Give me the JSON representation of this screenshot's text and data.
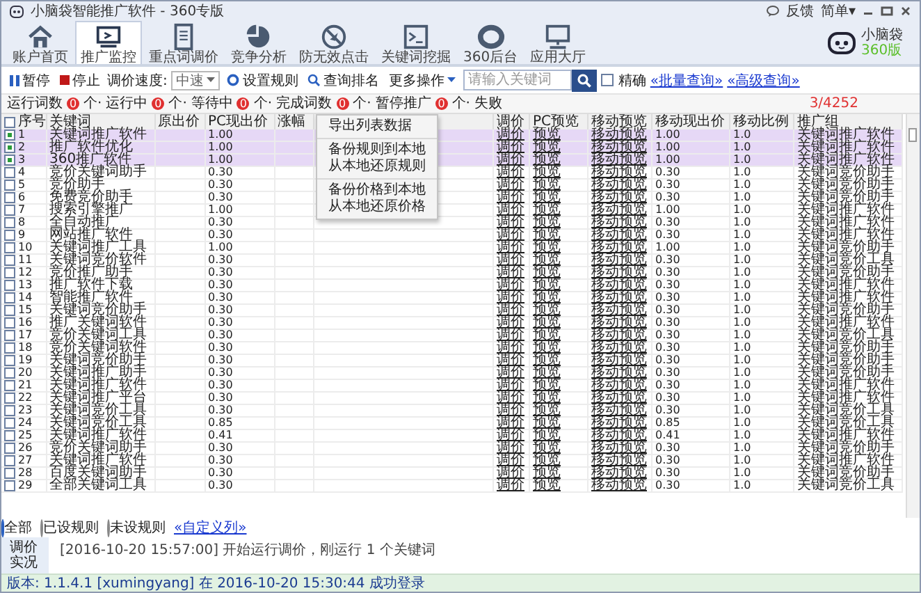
{
  "window": {
    "title": "小脑袋智能推广软件 - 360专版",
    "feedback": "反馈",
    "mode_menu": "简单▾",
    "logo_name": "小脑袋",
    "logo_edition": "360版"
  },
  "toolbar": [
    {
      "label": "账户首页",
      "selected": false
    },
    {
      "label": "推广监控",
      "selected": true
    },
    {
      "label": "重点词调价",
      "selected": false
    },
    {
      "label": "竞争分析",
      "selected": false
    },
    {
      "label": "防无效点击",
      "selected": false
    },
    {
      "label": "关键词挖掘",
      "selected": false
    },
    {
      "label": "360后台",
      "selected": false
    },
    {
      "label": "应用大厅",
      "selected": false
    }
  ],
  "actions": {
    "pause": "暂停",
    "stop": "停止",
    "speed_label": "调价速度:",
    "speed_value": "中速",
    "rules": "设置规则",
    "rank": "查询排名",
    "more": "更多操作",
    "search_placeholder": "请输入关键词",
    "exact": {
      "label": "精确",
      "checked": false
    },
    "batch_query": "«批量查询»",
    "advanced_query": "«高级查询»",
    "count": "3/4252"
  },
  "more_menu": [
    {
      "label": "导出列表数据",
      "separator_after": true
    },
    {
      "label": "备份规则到本地",
      "separator_after": false
    },
    {
      "label": "从本地还原规则",
      "separator_after": true
    },
    {
      "label": "备份价格到本地",
      "separator_after": false
    },
    {
      "label": "从本地还原价格",
      "separator_after": false
    }
  ],
  "stats": [
    {
      "label": "运行词数",
      "value": "0",
      "unit": "个·"
    },
    {
      "label": "运行中",
      "value": "0",
      "unit": "个·"
    },
    {
      "label": "等待中",
      "value": "0",
      "unit": "个·"
    },
    {
      "label": "完成词数",
      "value": "0",
      "unit": "个·"
    },
    {
      "label": "暂停推广",
      "value": "0",
      "unit": "个·"
    },
    {
      "label": "失败"
    }
  ],
  "table": {
    "all_checked": false,
    "columns": [
      "序号",
      "关键词",
      "原出价",
      "PC现出价",
      "涨幅",
      "调价",
      "PC预览",
      "移动预览",
      "移动现出价",
      "移动比例",
      "推广组"
    ],
    "rows": [
      {
        "checked": true,
        "no": "1",
        "keyword": "关键词推广软件",
        "pc_bid": "1.00",
        "adjust": "调价",
        "pc_preview": "预览",
        "mobile_preview": "移动预览",
        "mobile_bid": "1.00",
        "mobile_ratio": "1.0",
        "group": "关键词推广软件"
      },
      {
        "checked": true,
        "no": "2",
        "keyword": "推广软件优化",
        "pc_bid": "1.00",
        "adjust": "调价",
        "pc_preview": "预览",
        "mobile_preview": "移动预览",
        "mobile_bid": "1.00",
        "mobile_ratio": "1.0",
        "group": "关键词推广软件"
      },
      {
        "checked": true,
        "no": "3",
        "keyword": "360推广软件",
        "pc_bid": "1.00",
        "adjust": "调价",
        "pc_preview": "预览",
        "mobile_preview": "移动预览",
        "mobile_bid": "1.00",
        "mobile_ratio": "1.0",
        "group": "关键词推广软件"
      },
      {
        "checked": false,
        "no": "4",
        "keyword": "竞价关键词助手",
        "pc_bid": "0.30",
        "adjust": "调价",
        "pc_preview": "预览",
        "mobile_preview": "移动预览",
        "mobile_bid": "0.30",
        "mobile_ratio": "1.0",
        "group": "关键词竞价助手"
      },
      {
        "checked": false,
        "no": "5",
        "keyword": "竞价助手",
        "pc_bid": "0.30",
        "adjust": "调价",
        "pc_preview": "预览",
        "mobile_preview": "移动预览",
        "mobile_bid": "0.30",
        "mobile_ratio": "1.0",
        "group": "关键词竞价助手"
      },
      {
        "checked": false,
        "no": "6",
        "keyword": "免费竞价助手",
        "pc_bid": "0.30",
        "adjust": "调价",
        "pc_preview": "预览",
        "mobile_preview": "移动预览",
        "mobile_bid": "0.30",
        "mobile_ratio": "1.0",
        "group": "关键词竞价助手"
      },
      {
        "checked": false,
        "no": "7",
        "keyword": "搜索引擎推广",
        "pc_bid": "1.00",
        "adjust": "调价",
        "pc_preview": "预览",
        "mobile_preview": "移动预览",
        "mobile_bid": "1.00",
        "mobile_ratio": "1.0",
        "group": "关键词推广软件"
      },
      {
        "checked": false,
        "no": "8",
        "keyword": "全自动推广",
        "pc_bid": "0.30",
        "adjust": "调价",
        "pc_preview": "预览",
        "mobile_preview": "移动预览",
        "mobile_bid": "0.30",
        "mobile_ratio": "1.0",
        "group": "关键词推广软件"
      },
      {
        "checked": false,
        "no": "9",
        "keyword": "网站推广软件",
        "pc_bid": "0.30",
        "adjust": "调价",
        "pc_preview": "预览",
        "mobile_preview": "移动预览",
        "mobile_bid": "0.30",
        "mobile_ratio": "1.0",
        "group": "关键词推广软件"
      },
      {
        "checked": false,
        "no": "10",
        "keyword": "关键词推广工具",
        "pc_bid": "1.00",
        "adjust": "调价",
        "pc_preview": "预览",
        "mobile_preview": "移动预览",
        "mobile_bid": "1.00",
        "mobile_ratio": "1.0",
        "group": "关键词竞价助手"
      },
      {
        "checked": false,
        "no": "11",
        "keyword": "关键词竞价软件",
        "pc_bid": "0.30",
        "adjust": "调价",
        "pc_preview": "预览",
        "mobile_preview": "移动预览",
        "mobile_bid": "0.30",
        "mobile_ratio": "1.0",
        "group": "关键词竞价工具"
      },
      {
        "checked": false,
        "no": "12",
        "keyword": "竞价推广助手",
        "pc_bid": "0.30",
        "adjust": "调价",
        "pc_preview": "预览",
        "mobile_preview": "移动预览",
        "mobile_bid": "0.30",
        "mobile_ratio": "1.0",
        "group": "关键词竞价助手"
      },
      {
        "checked": false,
        "no": "13",
        "keyword": "推广软件下载",
        "pc_bid": "0.30",
        "adjust": "调价",
        "pc_preview": "预览",
        "mobile_preview": "移动预览",
        "mobile_bid": "0.30",
        "mobile_ratio": "1.0",
        "group": "关键词推广软件"
      },
      {
        "checked": false,
        "no": "14",
        "keyword": "智能推广软件",
        "pc_bid": "0.30",
        "adjust": "调价",
        "pc_preview": "预览",
        "mobile_preview": "移动预览",
        "mobile_bid": "0.30",
        "mobile_ratio": "1.0",
        "group": "关键词推广软件"
      },
      {
        "checked": false,
        "no": "15",
        "keyword": "关键词竞价助手",
        "pc_bid": "0.30",
        "adjust": "调价",
        "pc_preview": "预览",
        "mobile_preview": "移动预览",
        "mobile_bid": "0.30",
        "mobile_ratio": "1.0",
        "group": "关键词竞价助手"
      },
      {
        "checked": false,
        "no": "16",
        "keyword": "推广关键词软件",
        "pc_bid": "0.30",
        "adjust": "调价",
        "pc_preview": "预览",
        "mobile_preview": "移动预览",
        "mobile_bid": "0.30",
        "mobile_ratio": "1.0",
        "group": "关键词推广软件"
      },
      {
        "checked": false,
        "no": "17",
        "keyword": "竞价关键词工具",
        "pc_bid": "0.30",
        "adjust": "调价",
        "pc_preview": "预览",
        "mobile_preview": "移动预览",
        "mobile_bid": "0.30",
        "mobile_ratio": "1.0",
        "group": "关键词竞价工具"
      },
      {
        "checked": false,
        "no": "18",
        "keyword": "竞价关键词软件",
        "pc_bid": "0.30",
        "adjust": "调价",
        "pc_preview": "预览",
        "mobile_preview": "移动预览",
        "mobile_bid": "0.30",
        "mobile_ratio": "1.0",
        "group": "关键词竞价助手"
      },
      {
        "checked": false,
        "no": "19",
        "keyword": "关键词竞价助手",
        "pc_bid": "0.30",
        "adjust": "调价",
        "pc_preview": "预览",
        "mobile_preview": "移动预览",
        "mobile_bid": "0.30",
        "mobile_ratio": "1.0",
        "group": "关键词竞价助手"
      },
      {
        "checked": false,
        "no": "20",
        "keyword": "关键词推广助手",
        "pc_bid": "0.30",
        "adjust": "调价",
        "pc_preview": "预览",
        "mobile_preview": "移动预览",
        "mobile_bid": "0.30",
        "mobile_ratio": "1.0",
        "group": "关键词竞价助手"
      },
      {
        "checked": false,
        "no": "21",
        "keyword": "关键词推广软件",
        "pc_bid": "0.30",
        "adjust": "调价",
        "pc_preview": "预览",
        "mobile_preview": "移动预览",
        "mobile_bid": "0.30",
        "mobile_ratio": "1.0",
        "group": "关键词推广软件"
      },
      {
        "checked": false,
        "no": "22",
        "keyword": "关键词推广平台",
        "pc_bid": "0.30",
        "adjust": "调价",
        "pc_preview": "预览",
        "mobile_preview": "移动预览",
        "mobile_bid": "0.30",
        "mobile_ratio": "1.0",
        "group": "关键词推广软件"
      },
      {
        "checked": false,
        "no": "23",
        "keyword": "关键词竞价工具",
        "pc_bid": "0.30",
        "adjust": "调价",
        "pc_preview": "预览",
        "mobile_preview": "移动预览",
        "mobile_bid": "0.30",
        "mobile_ratio": "1.0",
        "group": "关键词竞价工具"
      },
      {
        "checked": false,
        "no": "24",
        "keyword": "关键词竞价工具",
        "pc_bid": "0.85",
        "adjust": "调价",
        "pc_preview": "预览",
        "mobile_preview": "移动预览",
        "mobile_bid": "0.85",
        "mobile_ratio": "1.0",
        "group": "关键词竞价工具"
      },
      {
        "checked": false,
        "no": "25",
        "keyword": "关键词推广软件",
        "pc_bid": "0.41",
        "adjust": "调价",
        "pc_preview": "预览",
        "mobile_preview": "移动预览",
        "mobile_bid": "0.41",
        "mobile_ratio": "1.0",
        "group": "关键词推广软件"
      },
      {
        "checked": false,
        "no": "26",
        "keyword": "竞价关键词助手",
        "pc_bid": "0.30",
        "adjust": "调价",
        "pc_preview": "预览",
        "mobile_preview": "移动预览",
        "mobile_bid": "0.30",
        "mobile_ratio": "1.0",
        "group": "关键词竞价助手"
      },
      {
        "checked": false,
        "no": "27",
        "keyword": "关键词推广软件",
        "pc_bid": "0.30",
        "adjust": "调价",
        "pc_preview": "预览",
        "mobile_preview": "移动预览",
        "mobile_bid": "0.30",
        "mobile_ratio": "1.0",
        "group": "关键词推广软件"
      },
      {
        "checked": false,
        "no": "28",
        "keyword": "百度关键词助手",
        "pc_bid": "0.30",
        "adjust": "调价",
        "pc_preview": "预览",
        "mobile_preview": "移动预览",
        "mobile_bid": "0.30",
        "mobile_ratio": "1.0",
        "group": "关键词竞价助手"
      },
      {
        "checked": false,
        "no": "29",
        "keyword": "全部关键词工具",
        "pc_bid": "0.30",
        "adjust": "调价",
        "pc_preview": "预览",
        "mobile_preview": "移动预览",
        "mobile_bid": "0.30",
        "mobile_ratio": "1.0",
        "group": "关键词竞价工具"
      }
    ]
  },
  "filters": [
    {
      "label": "全部",
      "selected": true
    },
    {
      "label": "已设规则",
      "selected": false
    },
    {
      "label": "未设规则",
      "selected": false
    }
  ],
  "custom_columns": "«自定义列»",
  "log": {
    "tab": "调价实况",
    "lines": [
      "[2016-10-20 15:57:00] 开始运行调价，刚运行 1 个关键词"
    ]
  },
  "status_bar": "版本: 1.1.4.1 [xumingyang] 在 2016-10-20 15:30:44 成功登录"
}
